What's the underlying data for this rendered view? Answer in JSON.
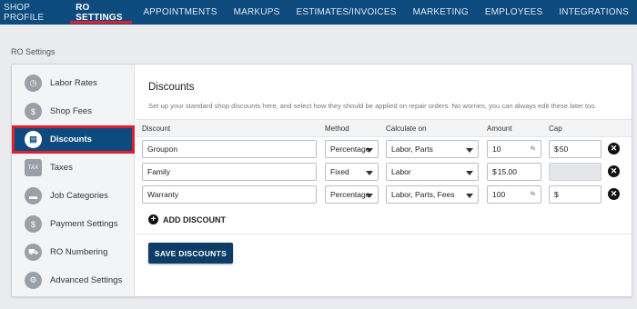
{
  "nav": {
    "tabs": [
      {
        "label": "SHOP PROFILE"
      },
      {
        "label": "RO SETTINGS",
        "active": true
      },
      {
        "label": "APPOINTMENTS"
      },
      {
        "label": "MARKUPS"
      },
      {
        "label": "ESTIMATES/INVOICES"
      },
      {
        "label": "MARKETING"
      },
      {
        "label": "EMPLOYEES"
      },
      {
        "label": "INTEGRATIONS"
      }
    ]
  },
  "section_label": "RO Settings",
  "sidebar": {
    "items": [
      {
        "label": "Labor Rates",
        "icon": "stopwatch-icon"
      },
      {
        "label": "Shop Fees",
        "icon": "money-hand-icon"
      },
      {
        "label": "Discounts",
        "icon": "discount-tag-icon",
        "active": true
      },
      {
        "label": "Taxes",
        "icon": "tax-icon"
      },
      {
        "label": "Job Categories",
        "icon": "folder-icon"
      },
      {
        "label": "Payment Settings",
        "icon": "dollar-icon"
      },
      {
        "label": "RO Numbering",
        "icon": "car-icon"
      },
      {
        "label": "Advanced Settings",
        "icon": "gear-icon"
      }
    ]
  },
  "main": {
    "title": "Discounts",
    "description": "Set up your standard shop discounts here, and select how they should be applied on repair orders. No worries, you can always edit these later too.",
    "columns": {
      "discount": "Discount",
      "method": "Method",
      "calculate_on": "Calculate on",
      "amount": "Amount",
      "cap": "Cap"
    },
    "rows": [
      {
        "name": "Groupon",
        "method": "Percentage",
        "calculate_on": "Labor, Parts",
        "amount": "10",
        "amount_suffix": "%",
        "cap_prefix": "$",
        "cap": "50"
      },
      {
        "name": "Family",
        "method": "Fixed",
        "calculate_on": "Labor",
        "amount_prefix": "$",
        "amount": "15.00",
        "cap": ""
      },
      {
        "name": "Warranty",
        "method": "Percentage",
        "calculate_on": "Labor, Parts, Fees",
        "amount": "100",
        "amount_suffix": "%",
        "cap_prefix": "$",
        "cap": ""
      }
    ],
    "add_label": "ADD DISCOUNT",
    "save_label": "SAVE DISCOUNTS"
  },
  "colors": {
    "nav_bg": "#0d4a7d",
    "accent_red": "#e02030",
    "save_button": "#0d3d66"
  }
}
